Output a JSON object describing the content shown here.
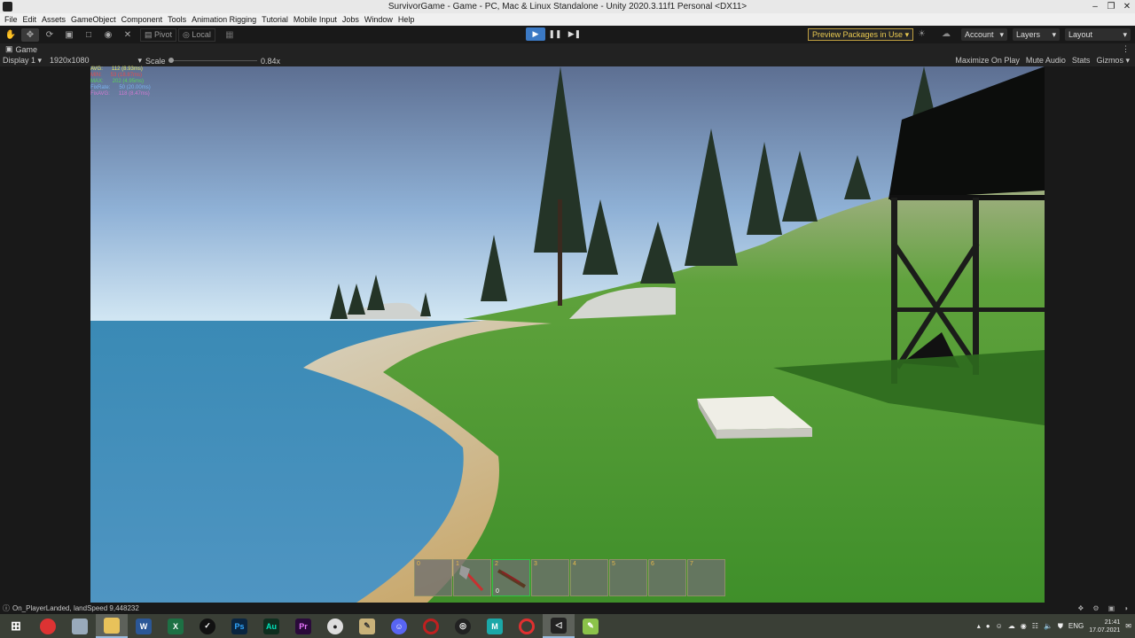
{
  "window": {
    "title": "SurvivorGame - Game - PC, Mac & Linux Standalone - Unity 2020.3.11f1 Personal <DX11>"
  },
  "menu": [
    "File",
    "Edit",
    "Assets",
    "GameObject",
    "Component",
    "Tools",
    "Animation Rigging",
    "Tutorial",
    "Mobile Input",
    "Jobs",
    "Window",
    "Help"
  ],
  "toolbar": {
    "pivot_label": "Pivot",
    "local_label": "Local",
    "preview_packages": "Preview Packages in Use",
    "account": "Account",
    "layers": "Layers",
    "layout": "Layout"
  },
  "game_tab": {
    "label": "Game"
  },
  "game_controls": {
    "display": "Display 1",
    "resolution": "1920x1080",
    "scale_label": "Scale",
    "scale_value": "0.84x",
    "maximize": "Maximize On Play",
    "mute": "Mute Audio",
    "stats": "Stats",
    "gizmos": "Gizmos"
  },
  "fps_stats": [
    {
      "label": "AVG:",
      "value": "112 (8.93ms)",
      "color": "#e6e65a"
    },
    {
      "label": "MIN:",
      "value": "53 (18.87ms)",
      "color": "#e05050"
    },
    {
      "label": "MAX:",
      "value": "202 (4.95ms)",
      "color": "#5ad25a"
    },
    {
      "label": "FixRate:",
      "value": "50 (20.00ms)",
      "color": "#7ab4f0"
    },
    {
      "label": "FixAVG:",
      "value": "118 (8.47ms)",
      "color": "#d27ad2"
    }
  ],
  "hotbar": {
    "slots": [
      {
        "num": "0",
        "item": "",
        "count": ""
      },
      {
        "num": "1",
        "item": "axe-icon",
        "count": ""
      },
      {
        "num": "2",
        "item": "rifle-icon",
        "count": "0"
      },
      {
        "num": "3",
        "item": "",
        "count": ""
      },
      {
        "num": "4",
        "item": "",
        "count": ""
      },
      {
        "num": "5",
        "item": "",
        "count": ""
      },
      {
        "num": "6",
        "item": "",
        "count": ""
      },
      {
        "num": "7",
        "item": "",
        "count": ""
      }
    ],
    "active_index": 2
  },
  "console": {
    "message": "On_PlayerLanded, landSpeed 9,448232"
  },
  "taskbar": {
    "apps": [
      "start",
      "chrome",
      "files",
      "explorer",
      "word",
      "excel",
      "inkscape",
      "photoshop",
      "audition",
      "premiere",
      "inkdrop",
      "tool",
      "discord",
      "opera",
      "obs",
      "maya",
      "opera-gx",
      "unity",
      "notepad"
    ],
    "lang": "ENG",
    "time": "21:41",
    "date": "17.07.2021"
  }
}
